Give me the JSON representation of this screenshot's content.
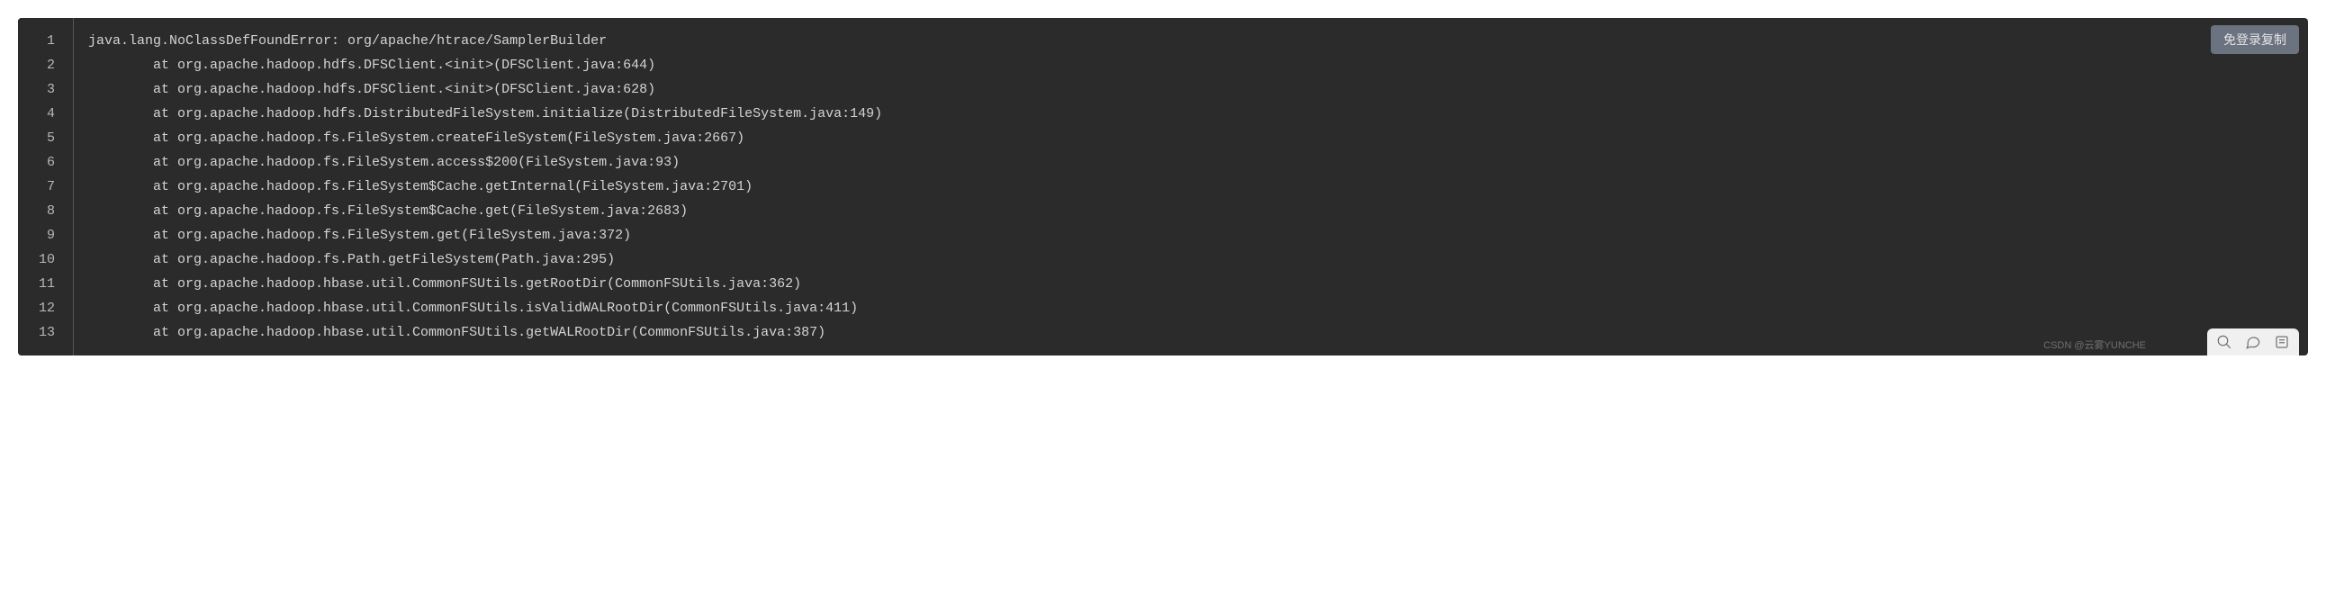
{
  "copy_button_label": "免登录复制",
  "watermark": "CSDN @云雾YUNCHE",
  "code": {
    "line_numbers": [
      "1",
      "2",
      "3",
      "4",
      "5",
      "6",
      "7",
      "8",
      "9",
      "10",
      "11",
      "12",
      "13"
    ],
    "lines": [
      "java.lang.NoClassDefFoundError: org/apache/htrace/SamplerBuilder",
      "        at org.apache.hadoop.hdfs.DFSClient.<init>(DFSClient.java:644)",
      "        at org.apache.hadoop.hdfs.DFSClient.<init>(DFSClient.java:628)",
      "        at org.apache.hadoop.hdfs.DistributedFileSystem.initialize(DistributedFileSystem.java:149)",
      "        at org.apache.hadoop.fs.FileSystem.createFileSystem(FileSystem.java:2667)",
      "        at org.apache.hadoop.fs.FileSystem.access$200(FileSystem.java:93)",
      "        at org.apache.hadoop.fs.FileSystem$Cache.getInternal(FileSystem.java:2701)",
      "        at org.apache.hadoop.fs.FileSystem$Cache.get(FileSystem.java:2683)",
      "        at org.apache.hadoop.fs.FileSystem.get(FileSystem.java:372)",
      "        at org.apache.hadoop.fs.Path.getFileSystem(Path.java:295)",
      "        at org.apache.hadoop.hbase.util.CommonFSUtils.getRootDir(CommonFSUtils.java:362)",
      "        at org.apache.hadoop.hbase.util.CommonFSUtils.isValidWALRootDir(CommonFSUtils.java:411)",
      "        at org.apache.hadoop.hbase.util.CommonFSUtils.getWALRootDir(CommonFSUtils.java:387)"
    ]
  }
}
